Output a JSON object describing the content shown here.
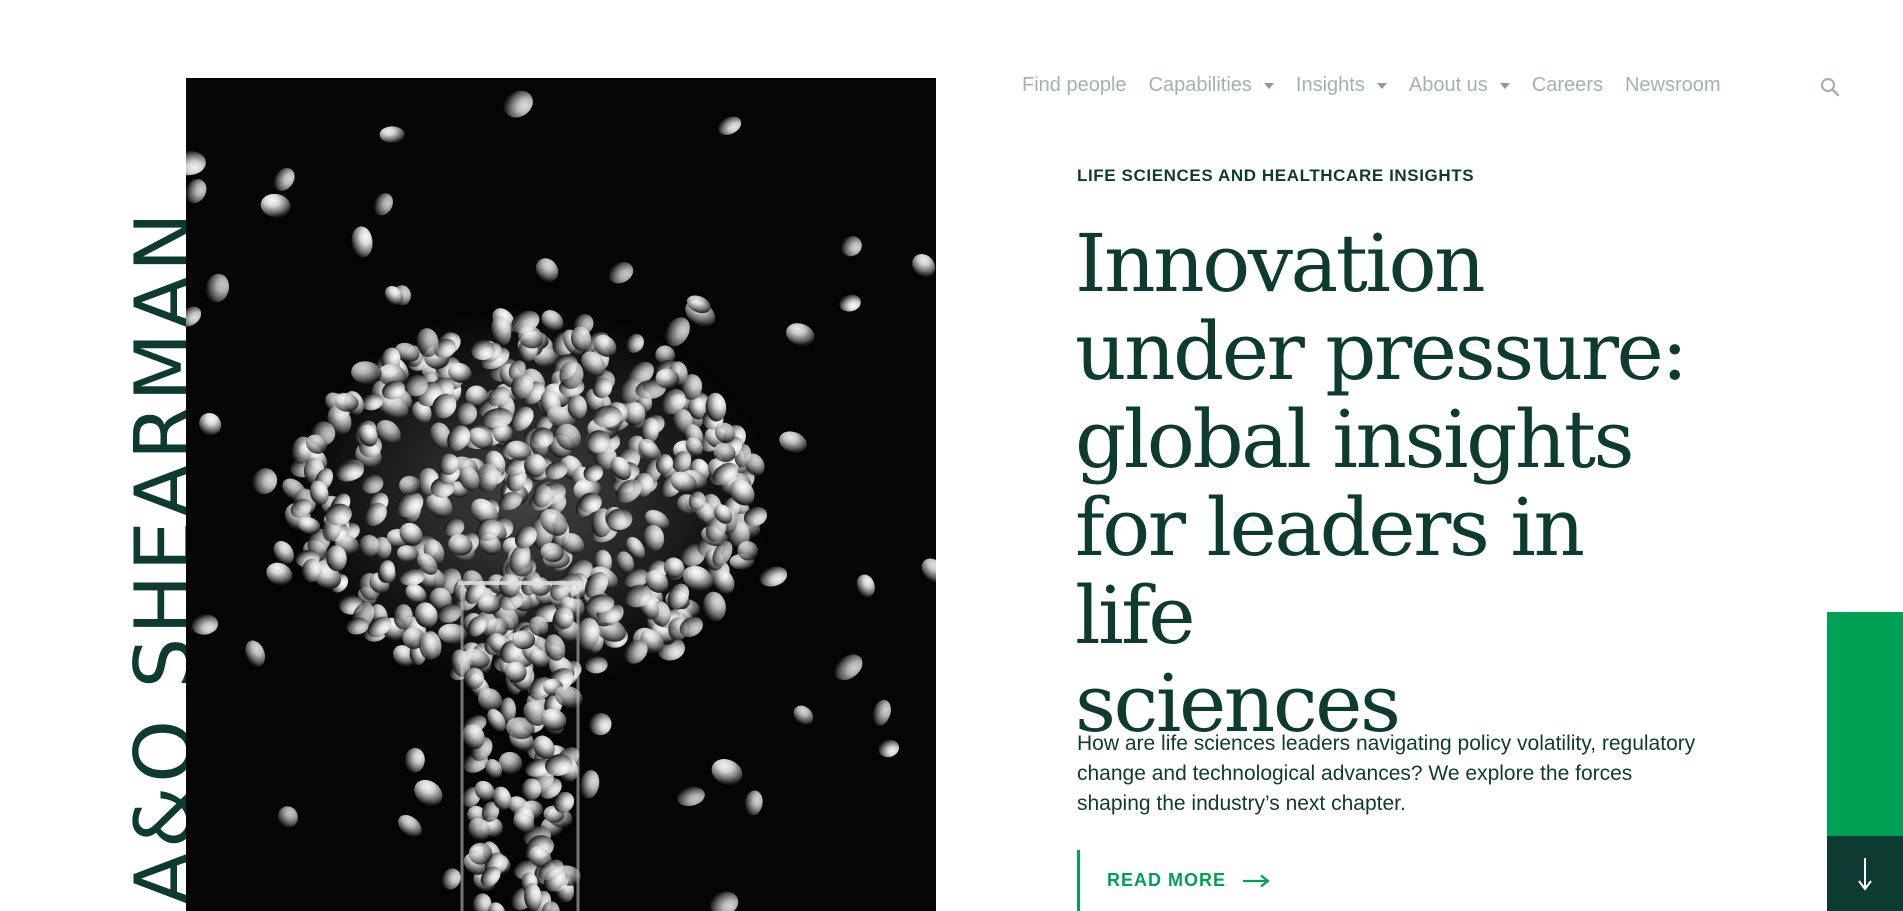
{
  "brand": {
    "logo_text": "A&O SHEARMAN"
  },
  "nav": {
    "items": [
      {
        "label": "Find people",
        "has_dropdown": false
      },
      {
        "label": "Capabilities",
        "has_dropdown": true
      },
      {
        "label": "Insights",
        "has_dropdown": true
      },
      {
        "label": "About us",
        "has_dropdown": true
      },
      {
        "label": "Careers",
        "has_dropdown": false
      },
      {
        "label": "Newsroom",
        "has_dropdown": false
      }
    ],
    "search_icon": "search-icon"
  },
  "hero": {
    "image_subject": "glass beads spilling from a test tube",
    "eyebrow": "LIFE SCIENCES AND HEALTHCARE INSIGHTS",
    "headline_lines": [
      "Innovation",
      "under pressure:",
      "global insights",
      "for leaders in life",
      "sciences"
    ],
    "intro_lines": [
      "How are life sciences leaders navigating policy volatility, regulatory",
      "change and technological advances? We explore the forces",
      "shaping the industry’s next chapter."
    ],
    "cta_label": "READ MORE",
    "cta_icon": "arrow-right-icon"
  },
  "scroll": {
    "icon": "arrow-down-icon"
  },
  "colors": {
    "brand_dark": "#0e3b31",
    "brand_green": "#00a055",
    "nav_text": "#a6b1ad",
    "image_bg": "#050505"
  }
}
